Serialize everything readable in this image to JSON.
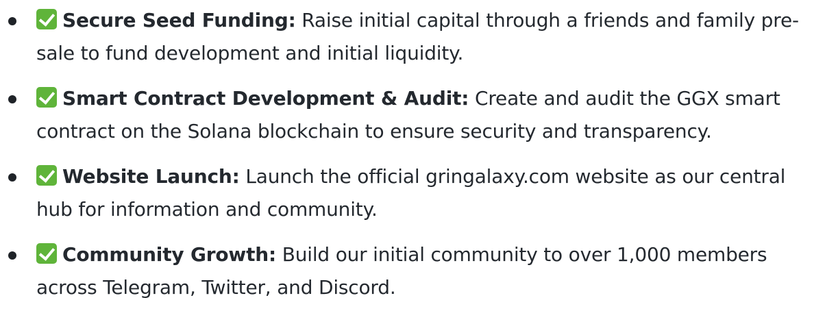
{
  "items": [
    {
      "icon": "check-box-icon",
      "title": "Secure Seed Funding:",
      "description": "Raise initial capital through a friends and family pre-sale to fund development and initial liquidity."
    },
    {
      "icon": "check-box-icon",
      "title": "Smart Contract Development & Audit:",
      "description": "Create and audit the GGX smart contract on the Solana blockchain to ensure security and transparency."
    },
    {
      "icon": "check-box-icon",
      "title": "Website Launch:",
      "description": "Launch the official gringalaxy.com website as our central hub for information and community."
    },
    {
      "icon": "check-box-icon",
      "title": "Community Growth:",
      "description": "Build our initial community to over 1,000 members across Telegram, Twitter, and Discord."
    }
  ],
  "colors": {
    "text": "#24292f",
    "bullet": "#1f2328",
    "check_bg": "#5fb43a",
    "check_mark": "#ffffff"
  }
}
